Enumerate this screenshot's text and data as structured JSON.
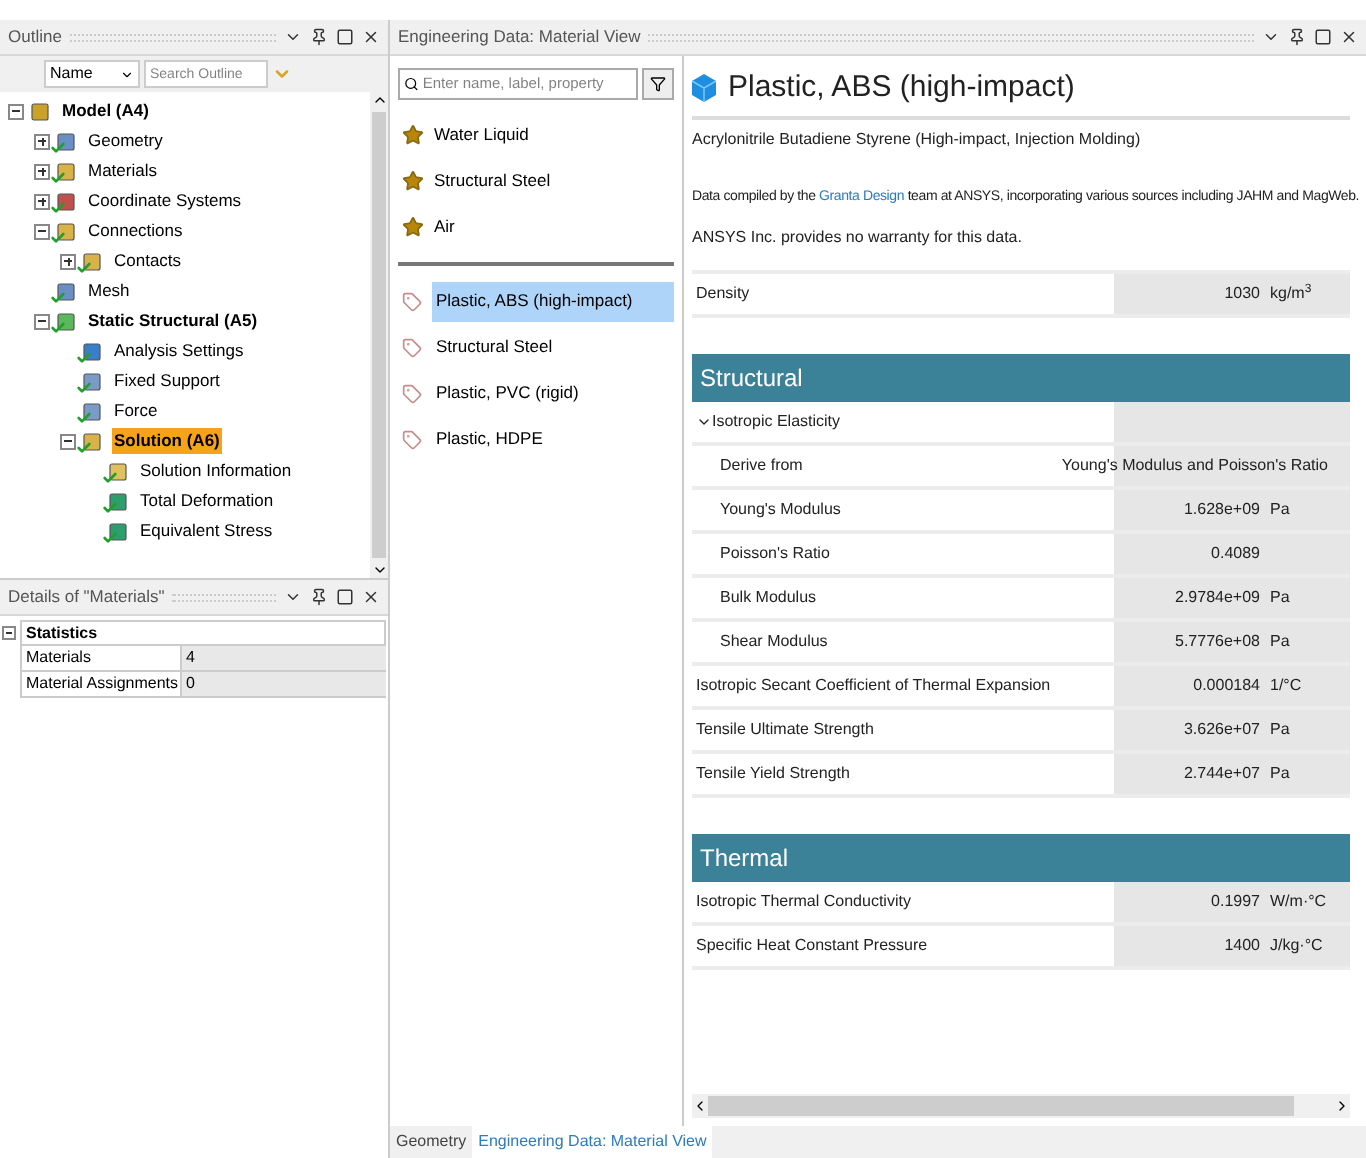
{
  "outline": {
    "title": "Outline",
    "column_select": "Name",
    "search": {
      "placeholder": "Search Outline"
    },
    "tree": [
      {
        "label": "Model (A4)",
        "bold": true,
        "kind": "model",
        "checked": false,
        "expanded": true,
        "selected": false,
        "children": [
          {
            "label": "Geometry",
            "kind": "geometry",
            "checked": true,
            "expanded": false,
            "selected": false
          },
          {
            "label": "Materials",
            "kind": "folder",
            "checked": true,
            "expanded": false,
            "selected": false
          },
          {
            "label": "Coordinate Systems",
            "kind": "coords",
            "checked": true,
            "expanded": false,
            "selected": false
          },
          {
            "label": "Connections",
            "kind": "folder",
            "checked": true,
            "expanded": true,
            "selected": false,
            "children": [
              {
                "label": "Contacts",
                "kind": "folder",
                "checked": true,
                "expanded": false,
                "selected": false
              }
            ]
          },
          {
            "label": "Mesh",
            "kind": "geometry",
            "checked": true,
            "selected": false
          },
          {
            "label": "Static Structural (A5)",
            "bold": true,
            "kind": "analysis",
            "checked": true,
            "expanded": true,
            "selected": false,
            "children": [
              {
                "label": "Analysis Settings",
                "kind": "settings",
                "checked": true,
                "selected": false
              },
              {
                "label": "Fixed Support",
                "kind": "support",
                "checked": true,
                "selected": false
              },
              {
                "label": "Force",
                "kind": "support",
                "checked": true,
                "selected": false
              },
              {
                "label": "Solution (A6)",
                "bold": true,
                "kind": "folder",
                "checked": true,
                "expanded": true,
                "selected": true,
                "children": [
                  {
                    "label": "Solution Information",
                    "kind": "info",
                    "checked": true,
                    "selected": false
                  },
                  {
                    "label": "Total Deformation",
                    "kind": "result",
                    "checked": true,
                    "selected": false
                  },
                  {
                    "label": "Equivalent Stress",
                    "kind": "result",
                    "checked": true,
                    "selected": false
                  }
                ]
              }
            ]
          }
        ]
      }
    ]
  },
  "details": {
    "title": "Details of \"Materials\"",
    "group": {
      "label": "Statistics",
      "expanded": true
    },
    "rows": [
      {
        "label": "Materials",
        "value": "4"
      },
      {
        "label": "Material Assignments",
        "value": "0"
      }
    ]
  },
  "material_view": {
    "title": "Engineering Data: Material View",
    "search": {
      "placeholder": "Enter name, label, property"
    },
    "favorites": [
      {
        "label": "Water Liquid"
      },
      {
        "label": "Structural Steel"
      },
      {
        "label": "Air"
      }
    ],
    "materials": [
      {
        "label": "Plastic, ABS (high-impact)",
        "selected": true
      },
      {
        "label": "Structural Steel",
        "selected": false
      },
      {
        "label": "Plastic, PVC (rigid)",
        "selected": false
      },
      {
        "label": "Plastic, HDPE",
        "selected": false
      }
    ],
    "heading": "Plastic, ABS (high-impact)",
    "subtitle": "Acrylonitrile Butadiene Styrene (High-impact, Injection Molding)",
    "note_before_link": "Data compiled by the",
    "link": "Granta Design",
    "note_after_link": "team at ANSYS, incorporating various sources including JAHM and MagWeb.",
    "disclaimer": "ANSYS Inc. provides no warranty for this data.",
    "general": [
      {
        "label": "Density",
        "value": "1030",
        "unit": "kg/m$^{3}$",
        "kind": "row"
      }
    ],
    "sections": [
      {
        "title": "Structural",
        "rows": [
          {
            "label": "Isotropic Elasticity",
            "kind": "group",
            "expanded": true
          },
          {
            "label": "Derive from",
            "value": "Young's Modulus and Poisson's Ratio",
            "kind": "sub"
          },
          {
            "label": "Young's Modulus",
            "value": "1.628e+09",
            "unit": "Pa",
            "kind": "sub"
          },
          {
            "label": "Poisson's Ratio",
            "value": "0.4089",
            "kind": "sub"
          },
          {
            "label": "Bulk Modulus",
            "value": "2.9784e+09",
            "unit": "Pa",
            "kind": "sub"
          },
          {
            "label": "Shear Modulus",
            "value": "5.7776e+08",
            "unit": "Pa",
            "kind": "sub"
          },
          {
            "label": "Isotropic Secant Coefficient of Thermal Expansion",
            "value": "0.000184",
            "unit": "1/°C",
            "kind": "row"
          },
          {
            "label": "Tensile Ultimate Strength",
            "value": "3.626e+07",
            "unit": "Pa",
            "kind": "row"
          },
          {
            "label": "Tensile Yield Strength",
            "value": "2.744e+07",
            "unit": "Pa",
            "kind": "row"
          }
        ]
      },
      {
        "title": "Thermal",
        "rows": [
          {
            "label": "Isotropic Thermal Conductivity",
            "value": "0.1997",
            "unit": "W/m·°C",
            "kind": "row"
          },
          {
            "label": "Specific Heat Constant Pressure",
            "value": "1400",
            "unit": "J/kg·°C",
            "kind": "row"
          }
        ]
      }
    ]
  },
  "bottom_tabs": [
    {
      "label": "Geometry",
      "selected": false
    },
    {
      "label": "Engineering Data: Material View",
      "selected": true
    }
  ]
}
